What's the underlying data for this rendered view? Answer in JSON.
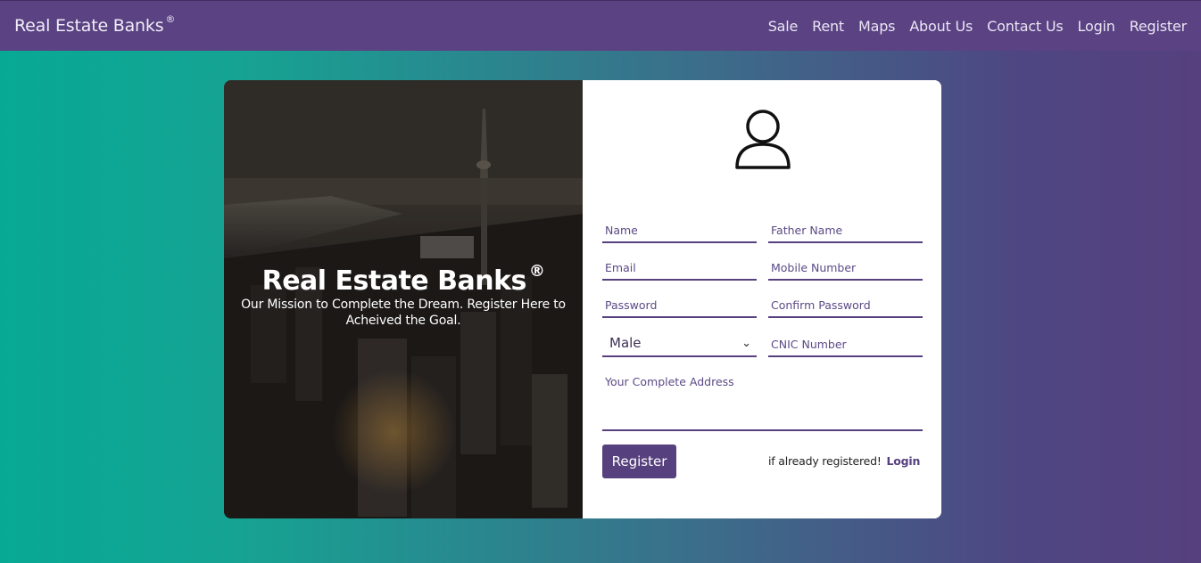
{
  "navbar": {
    "brand": "Real Estate Banks",
    "brand_mark": "®",
    "links": [
      "Sale",
      "Rent",
      "Maps",
      "About Us",
      "Contact Us",
      "Login",
      "Register"
    ]
  },
  "hero": {
    "title": "Real Estate Banks",
    "title_mark": "®",
    "subtitle": "Our Mission to Complete the Dream. Register Here to Acheived the Goal."
  },
  "form": {
    "avatar_icon": "user-icon",
    "name_placeholder": "Name",
    "father_name_placeholder": "Father Name",
    "email_placeholder": "Email",
    "mobile_placeholder": "Mobile Number",
    "password_placeholder": "Password",
    "confirm_password_placeholder": "Confirm Password",
    "gender_selected": "Male",
    "cnic_placeholder": "CNIC Number",
    "address_placeholder": "Your Complete Address",
    "register_button": "Register",
    "already_registered_text": "if already registered!",
    "login_link": "Login"
  },
  "colors": {
    "brand_purple": "#56407e",
    "teal": "#07a995",
    "white": "#ffffff"
  }
}
